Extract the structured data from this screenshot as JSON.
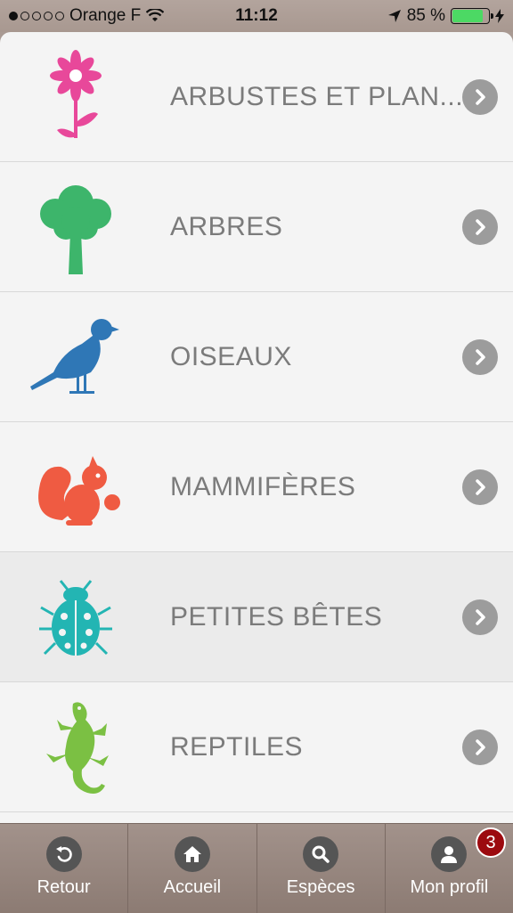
{
  "status_bar": {
    "carrier": "Orange F",
    "signal_bars": 1,
    "time": "11:12",
    "battery": "85 %",
    "battery_level": 0.85
  },
  "categories": [
    {
      "label": "ARBUSTES ET PLAN...",
      "icon": "flower-icon",
      "color": "#e8489a"
    },
    {
      "label": "ARBRES",
      "icon": "tree-icon",
      "color": "#3db56b"
    },
    {
      "label": "OISEAUX",
      "icon": "bird-icon",
      "color": "#2f77b6"
    },
    {
      "label": "MAMMIFÈRES",
      "icon": "squirrel-icon",
      "color": "#ef5b42"
    },
    {
      "label": "PETITES BÊTES",
      "icon": "ladybug-icon",
      "color": "#23b5b3"
    },
    {
      "label": "REPTILES",
      "icon": "lizard-icon",
      "color": "#7bc043"
    }
  ],
  "tab_bar": {
    "tabs": [
      {
        "label": "Retour",
        "icon": "back-arrow-icon"
      },
      {
        "label": "Accueil",
        "icon": "home-icon"
      },
      {
        "label": "Espèces",
        "icon": "search-icon"
      },
      {
        "label": "Mon profil",
        "icon": "user-icon",
        "badge": "3"
      }
    ]
  }
}
